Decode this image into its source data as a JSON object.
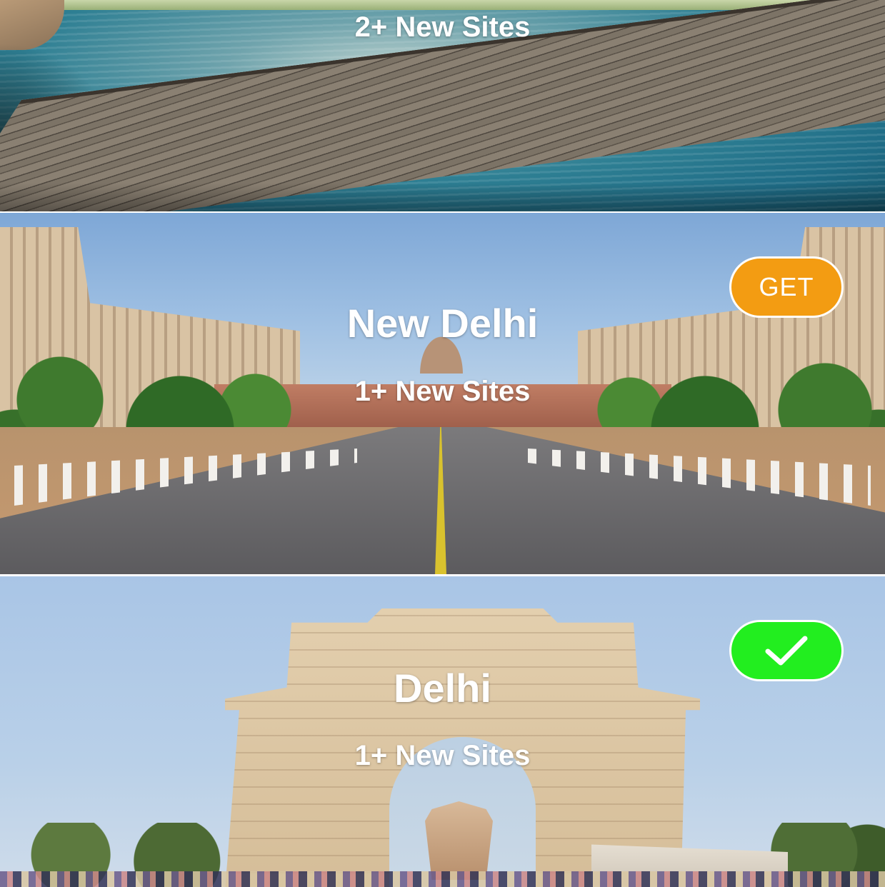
{
  "cards": [
    {
      "title": "",
      "subtitle": "2+ New Sites"
    },
    {
      "title": "New Delhi",
      "subtitle": "1+ New Sites",
      "action": {
        "type": "get",
        "label": "GET",
        "color": "#f39c12"
      }
    },
    {
      "title": "Delhi",
      "subtitle": "1+ New Sites",
      "action": {
        "type": "installed",
        "icon": "checkmark-icon",
        "color": "#22ee1f"
      }
    }
  ]
}
